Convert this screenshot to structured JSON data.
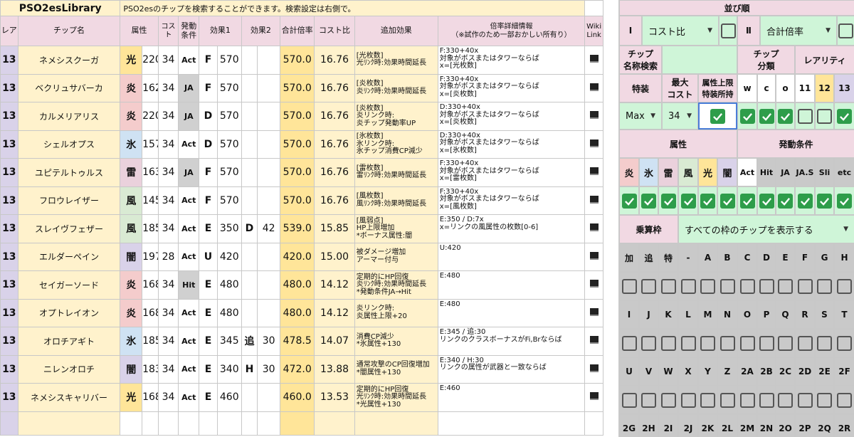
{
  "title": "PSO2esLibrary",
  "description": "PSO2esのチップを検索することができます。検索設定は右側で。",
  "headers": [
    "レア",
    "チップ名",
    "属性",
    "コスト",
    "発動条件",
    "効果1",
    "",
    "効果2",
    "",
    "合計倍率",
    "コスト比",
    "追加効果",
    "倍率詳細情報\n（※試作のため一部おかしい所有り）",
    "Wiki Link"
  ],
  "rows": [
    {
      "rare": "13",
      "name": "ネメシスクーガ",
      "element": "光",
      "hp": "220",
      "cost": "34",
      "trigger": "Act",
      "e1": "F",
      "v1": "570",
      "e2": "",
      "v2": "",
      "total": "570.0",
      "ratio": "16.76",
      "add": "[光枚数]\n光ﾘﾝｸ時:効果時間延長",
      "info": "F:330+40x\n対象がボスまたはタワーならば\nx=[光枚数]"
    },
    {
      "rare": "13",
      "name": "ベクリュサバーカ",
      "element": "炎",
      "hp": "162",
      "cost": "34",
      "trigger": "JA",
      "e1": "F",
      "v1": "570",
      "e2": "",
      "v2": "",
      "total": "570.0",
      "ratio": "16.76",
      "add": "[炎枚数]\n炎ﾘﾝｸ時:効果時間延長",
      "info": "F:330+40x\n対象がボスまたはタワーならば\nx=[炎枚数]"
    },
    {
      "rare": "13",
      "name": "カルメリアリス",
      "element": "炎",
      "hp": "220",
      "cost": "34",
      "trigger": "JA",
      "e1": "D",
      "v1": "570",
      "e2": "",
      "v2": "",
      "total": "570.0",
      "ratio": "16.76",
      "add": "[炎枚数]\n炎リンク時:\n炎チップ発動率UP",
      "info": "D:330+40x\n対象がボスまたはタワーならば\nx=[炎枚数]"
    },
    {
      "rare": "13",
      "name": "シェルオプス",
      "element": "氷",
      "hp": "157",
      "cost": "34",
      "trigger": "Act",
      "e1": "D",
      "v1": "570",
      "e2": "",
      "v2": "",
      "total": "570.0",
      "ratio": "16.76",
      "add": "[氷枚数]\n氷リンク時:\n氷チップ消費CP減少",
      "info": "D:330+40x\n対象がボスまたはタワーならば\nx=[氷枚数]"
    },
    {
      "rare": "13",
      "name": "ユピテルトゥルス",
      "element": "雷",
      "hp": "163",
      "cost": "34",
      "trigger": "JA",
      "e1": "F",
      "v1": "570",
      "e2": "",
      "v2": "",
      "total": "570.0",
      "ratio": "16.76",
      "add": "[雷枚数]\n雷ﾘﾝｸ時:効果時間延長",
      "info": "F:330+40x\n対象がボスまたはタワーならば\nx=[雷枚数]"
    },
    {
      "rare": "13",
      "name": "フロウレイザー",
      "element": "風",
      "hp": "145",
      "cost": "34",
      "trigger": "Act",
      "e1": "F",
      "v1": "570",
      "e2": "",
      "v2": "",
      "total": "570.0",
      "ratio": "16.76",
      "add": "[風枚数]\n風ﾘﾝｸ時:効果時間延長",
      "info": "F:330+40x\n対象がボスまたはタワーならば\nx=[風枚数]"
    },
    {
      "rare": "13",
      "name": "スレイヴフェザー",
      "element": "風",
      "hp": "185",
      "cost": "34",
      "trigger": "Act",
      "e1": "E",
      "v1": "350",
      "e2": "D",
      "v2": "42",
      "total": "539.0",
      "ratio": "15.85",
      "add": "[風弱点]\nHP上限増加\n*ボーナス属性:闇",
      "info": "E:350 / D:7x\nx=リンクの風属性の枚数[0-6]"
    },
    {
      "rare": "13",
      "name": "エルダーペイン",
      "element": "闇",
      "hp": "197",
      "cost": "28",
      "trigger": "Act",
      "e1": "U",
      "v1": "420",
      "e2": "",
      "v2": "",
      "total": "420.0",
      "ratio": "15.00",
      "add": "被ダメージ増加\nアーマー付与",
      "info": "U:420"
    },
    {
      "rare": "13",
      "name": "セイガーソード",
      "element": "炎",
      "hp": "168",
      "cost": "34",
      "trigger": "Hit",
      "e1": "E",
      "v1": "480",
      "e2": "",
      "v2": "",
      "total": "480.0",
      "ratio": "14.12",
      "add": "定期的にHP回復\n炎ﾘﾝｸ時:効果時間延長\n*発動条件JA→Hit",
      "info": "E:480"
    },
    {
      "rare": "13",
      "name": "オプトレイオン",
      "element": "炎",
      "hp": "168",
      "cost": "34",
      "trigger": "Act",
      "e1": "E",
      "v1": "480",
      "e2": "",
      "v2": "",
      "total": "480.0",
      "ratio": "14.12",
      "add": "炎リンク時:\n炎属性上限+20",
      "info": "E:480"
    },
    {
      "rare": "13",
      "name": "オロチアギト",
      "element": "氷",
      "hp": "185",
      "cost": "34",
      "trigger": "Act",
      "e1": "E",
      "v1": "345",
      "e2": "追",
      "v2": "30",
      "total": "478.5",
      "ratio": "14.07",
      "add": "消費CP減少\n*氷属性+130",
      "info": "E:345 / 追:30\nリンクのクラスボーナスがFi,Brならば"
    },
    {
      "rare": "13",
      "name": "ニレンオロチ",
      "element": "闇",
      "hp": "183",
      "cost": "34",
      "trigger": "Act",
      "e1": "E",
      "v1": "340",
      "e2": "H",
      "v2": "30",
      "total": "472.0",
      "ratio": "13.88",
      "add": "通常攻撃のCP回復増加\n*闇属性+130",
      "info": "E:340 / H:30\nリンクの属性が武器と一致ならば"
    },
    {
      "rare": "13",
      "name": "ネメシスキャリバー",
      "element": "光",
      "hp": "168",
      "cost": "34",
      "trigger": "Act",
      "e1": "E",
      "v1": "460",
      "e2": "",
      "v2": "",
      "total": "460.0",
      "ratio": "13.53",
      "add": "定期的にHP回復\n光ﾘﾝｸ時:効果時間延長\n*光属性+130",
      "info": "E:460"
    }
  ],
  "side": {
    "sort_title": "並び順",
    "sort1_label": "Ⅰ",
    "sort1_value": "コスト比",
    "sort2_label": "Ⅱ",
    "sort2_value": "合計倍率",
    "chip_name_search": "チップ\n名称検索",
    "chip_class": "チップ\n分類",
    "rarity": "レアリティ",
    "tokuso": "特装",
    "max_cost": "最大\nコスト",
    "attr_limit": "属性上限\n特装所持",
    "classes": [
      "w",
      "c",
      "o"
    ],
    "rarities": [
      "11",
      "12",
      "13"
    ],
    "tokuso_value": "Max",
    "max_cost_value": "34",
    "zokusei": "属性",
    "hatsudo": "発動条件",
    "elements": [
      "炎",
      "氷",
      "雷",
      "風",
      "光",
      "闇"
    ],
    "triggers": [
      "Act",
      "Hit",
      "JA",
      "JA.S",
      "Sli",
      "etc"
    ],
    "jousan_label": "乗算枠",
    "jousan_value": "すべての枠のチップを表示する",
    "slots_row1": [
      "加",
      "追",
      "特",
      "-",
      "A",
      "B",
      "C",
      "D",
      "E",
      "F",
      "G",
      "H"
    ],
    "slots_row2": [
      "I",
      "J",
      "K",
      "L",
      "M",
      "N",
      "O",
      "P",
      "Q",
      "R",
      "S",
      "T"
    ],
    "slots_row3": [
      "U",
      "V",
      "W",
      "X",
      "Y",
      "Z",
      "2A",
      "2B",
      "2C",
      "2D",
      "2E",
      "2F"
    ],
    "slots_row4": [
      "2G",
      "2H",
      "2I",
      "2J",
      "2K",
      "2L",
      "2M",
      "2N",
      "2O",
      "2P",
      "2Q",
      "2R"
    ],
    "checks_class": [
      true,
      true,
      true
    ],
    "checks_rarity": [
      false,
      false,
      true
    ],
    "checks_elements": [
      true,
      true,
      true,
      true,
      true,
      true
    ],
    "checks_triggers": [
      true,
      true,
      true,
      true,
      true,
      true
    ],
    "attr_limit_checked": true
  }
}
